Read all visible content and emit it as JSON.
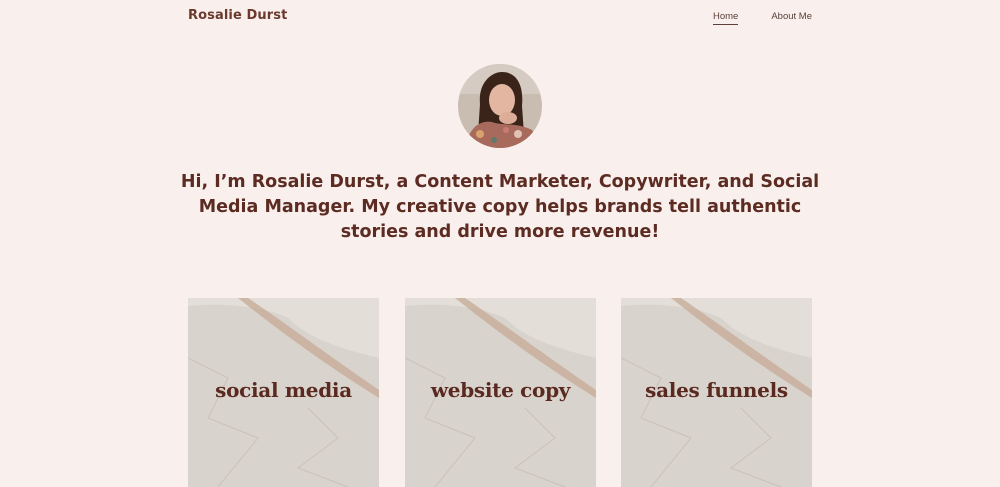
{
  "header": {
    "site_title": "Rosalie Durst",
    "nav": [
      {
        "label": "Home",
        "active": true
      },
      {
        "label": "About Me",
        "active": false
      }
    ]
  },
  "intro": {
    "text": "Hi, I’m Rosalie Durst, a Content Marketer, Copywriter, and Social Media Manager. My creative copy helps brands tell authentic stories and drive more revenue!"
  },
  "cards": [
    {
      "label": "social media"
    },
    {
      "label": "website copy"
    },
    {
      "label": "sales funnels"
    }
  ],
  "colors": {
    "background": "#f9f0ed",
    "accent_text": "#5c2b22",
    "paper": "#d8d2cc"
  }
}
